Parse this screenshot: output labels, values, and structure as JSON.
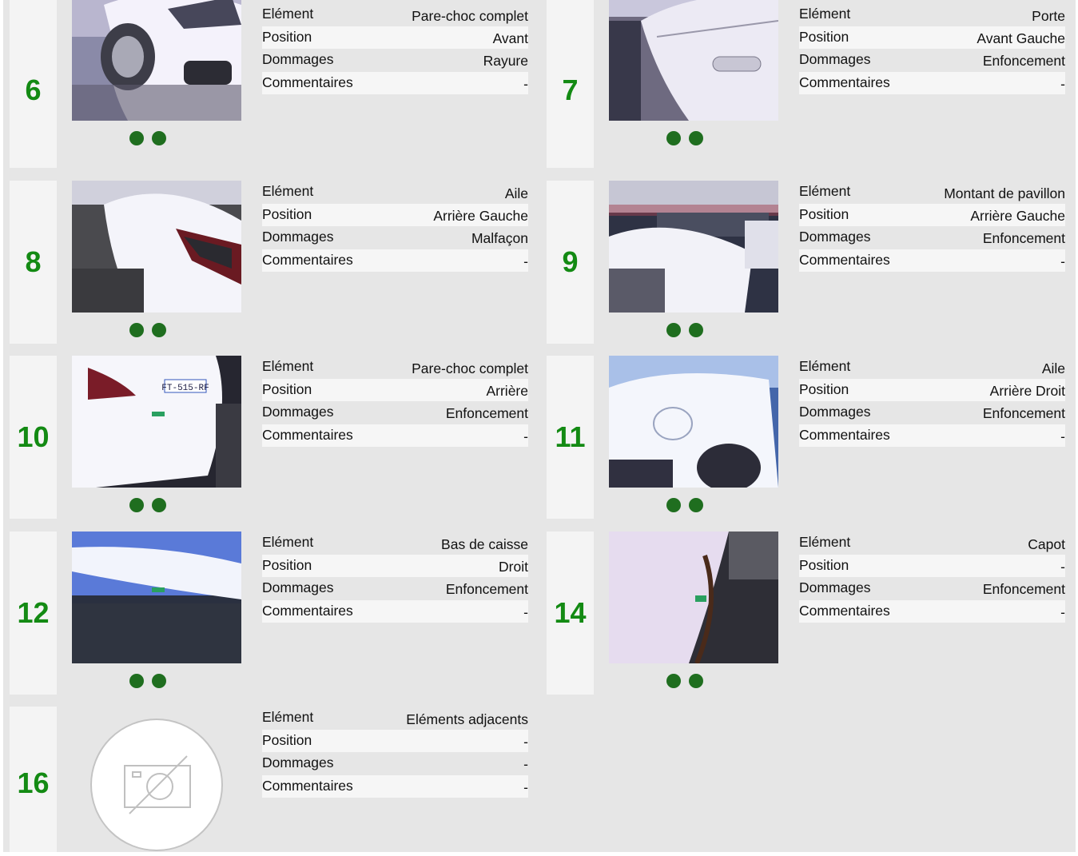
{
  "labels": {
    "element": "Elément",
    "position": "Position",
    "damages": "Dommages",
    "comments": "Commentaires"
  },
  "accent_color": "#138a13",
  "dot_color": "#1f6e1f",
  "items": [
    {
      "num": "6",
      "element": "Pare-choc complet",
      "position": "Avant",
      "damages": "Rayure",
      "comments": "-",
      "photo": "front-bumper-scratch",
      "dots": 2
    },
    {
      "num": "7",
      "element": "Porte",
      "position": "Avant Gauche",
      "damages": "Enfoncement",
      "comments": "-",
      "photo": "front-left-door",
      "dots": 2
    },
    {
      "num": "8",
      "element": "Aile",
      "position": "Arrière Gauche",
      "damages": "Malfaçon",
      "comments": "-",
      "photo": "rear-left-fender",
      "dots": 2
    },
    {
      "num": "9",
      "element": "Montant de pavillon",
      "position": "Arrière Gauche",
      "damages": "Enfoncement",
      "comments": "-",
      "photo": "rear-pillar-parking-lot",
      "dots": 2
    },
    {
      "num": "10",
      "element": "Pare-choc complet",
      "position": "Arrière",
      "damages": "Enfoncement",
      "comments": "-",
      "photo": "rear-bumper-plate",
      "dots": 2,
      "plate": "FT-515-RF"
    },
    {
      "num": "11",
      "element": "Aile",
      "position": "Arrière Droit",
      "damages": "Enfoncement",
      "comments": "-",
      "photo": "rear-right-fender",
      "dots": 2
    },
    {
      "num": "12",
      "element": "Bas de caisse",
      "position": "Droit",
      "damages": "Enfoncement",
      "comments": "-",
      "photo": "right-rocker-panel",
      "dots": 2
    },
    {
      "num": "14",
      "element": "Capot",
      "position": "-",
      "damages": "Enfoncement",
      "comments": "-",
      "photo": "hood",
      "dots": 2
    },
    {
      "num": "16",
      "element": "Eléments adjacents",
      "position": "-",
      "damages": "-",
      "comments": "-",
      "photo": "no-photo",
      "dots": 0
    }
  ]
}
